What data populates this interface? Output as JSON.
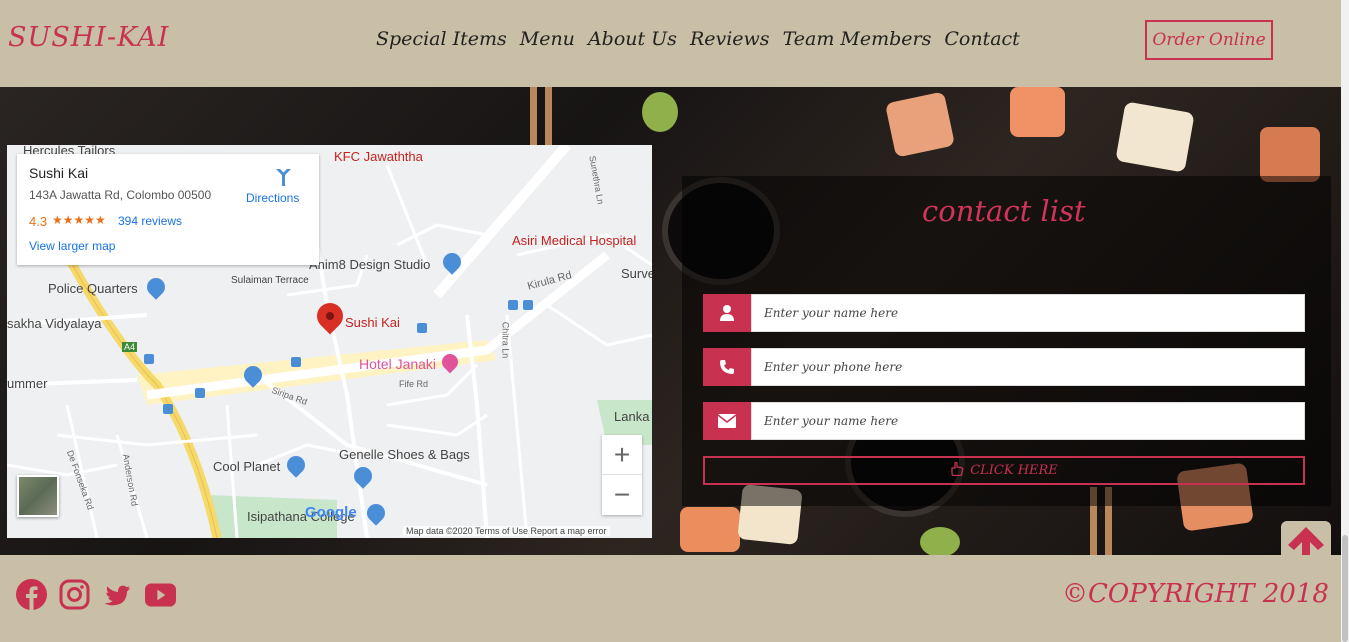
{
  "header": {
    "logo": "SUSHI-KAI",
    "nav": [
      "Special Items",
      "Menu",
      "About Us",
      "Reviews",
      "Team Members",
      "Contact"
    ],
    "order_button": "Order Online"
  },
  "map": {
    "place_name": "Sushi Kai",
    "address": "143A Jawatta Rd, Colombo 00500",
    "rating": "4.3",
    "stars": "★★★★★",
    "reviews": "394 reviews",
    "view_larger": "View larger map",
    "directions": "Directions",
    "labels": {
      "hercules": "Hercules Tailors",
      "kfc": "KFC Jawaththa",
      "asiri": "Asiri Medical Hospital",
      "anim8": "Anim8 Design Studio",
      "police": "Police Quarters",
      "sulaiman": "Sulaiman Terrace",
      "kirula": "Kirula Rd",
      "survey": "Surve",
      "vidyalaya": "sakha Vidyalaya",
      "sushi_kai": "Sushi Kai",
      "hotel_janaki": "Hotel Janaki",
      "summer": "ummer",
      "siripa": "Siripa Rd",
      "fife": "Fife Rd",
      "lanka": "Lanka",
      "cool_planet": "Cool Planet",
      "genelle": "Genelle Shoes & Bags",
      "isipathana": "Isipathana College",
      "de_fonseka": "De Fonseka Rd",
      "anderson": "Anderson Rd",
      "chitra": "Chitra Ln",
      "sunethra": "Sunethra Ln",
      "a4": "A4"
    },
    "google": "Google",
    "footer_text": "Map data ©2020  Terms of Use  Report a map error",
    "zoom_in": "+",
    "zoom_out": "−"
  },
  "contact": {
    "title": "contact list",
    "name_placeholder": "Enter your name here",
    "phone_placeholder": "Enter your phone here",
    "email_placeholder": "Enter your name here",
    "submit_label": "CLICK HERE"
  },
  "footer": {
    "social_icons": [
      "facebook-icon",
      "instagram-icon",
      "twitter-icon",
      "youtube-icon"
    ],
    "copyright": "©COPYRIGHT 2018"
  },
  "colors": {
    "accent": "#c8314f",
    "beige": "#c9bea6"
  }
}
